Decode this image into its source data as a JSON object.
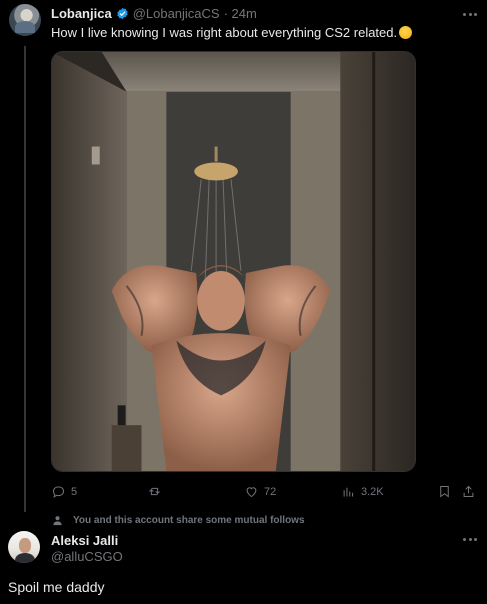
{
  "post": {
    "author_name": "Lobanjica",
    "author_handle": "@LobanjicaCS",
    "time": "· 24m",
    "text": "How I live knowing I was right about everything CS2 related.",
    "emoji_icon": "face-with-open-mouth-emoji",
    "verified_icon": "verified-badge-icon",
    "media_alt": "photo"
  },
  "actions": {
    "replies": "5",
    "retweets": "",
    "likes": "72",
    "views": "3.2K"
  },
  "mutual_follows": "You and this account share some mutual follows",
  "reply": {
    "author_name": "Aleksi Jalli",
    "author_handle": "@alluCSGO",
    "text": "Spoil me daddy"
  },
  "colors": {
    "background": "#000000",
    "text": "#e7e9ea",
    "muted": "#71767b",
    "verified": "#1d9bf0"
  }
}
